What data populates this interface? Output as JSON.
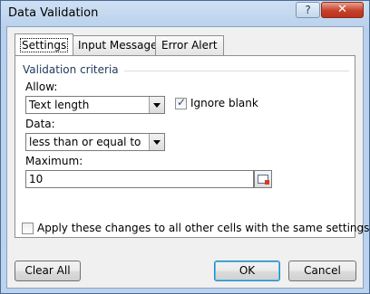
{
  "window": {
    "title": "Data Validation",
    "help_label": "?",
    "close_label": "✕"
  },
  "tabs": [
    {
      "label": "Settings",
      "active": true
    },
    {
      "label": "Input Message",
      "active": false
    },
    {
      "label": "Error Alert",
      "active": false
    }
  ],
  "criteria": {
    "group_label": "Validation criteria",
    "allow_label": "Allow:",
    "allow_value": "Text length",
    "ignore_blank_label": "Ignore blank",
    "ignore_blank_checked": true,
    "data_label": "Data:",
    "data_value": "less than or equal to",
    "maximum_label": "Maximum:",
    "maximum_value": "10"
  },
  "apply_all_label": "Apply these changes to all other cells with the same settings",
  "apply_all_checked": false,
  "buttons": {
    "clear_all": "Clear All",
    "ok": "OK",
    "cancel": "Cancel"
  }
}
